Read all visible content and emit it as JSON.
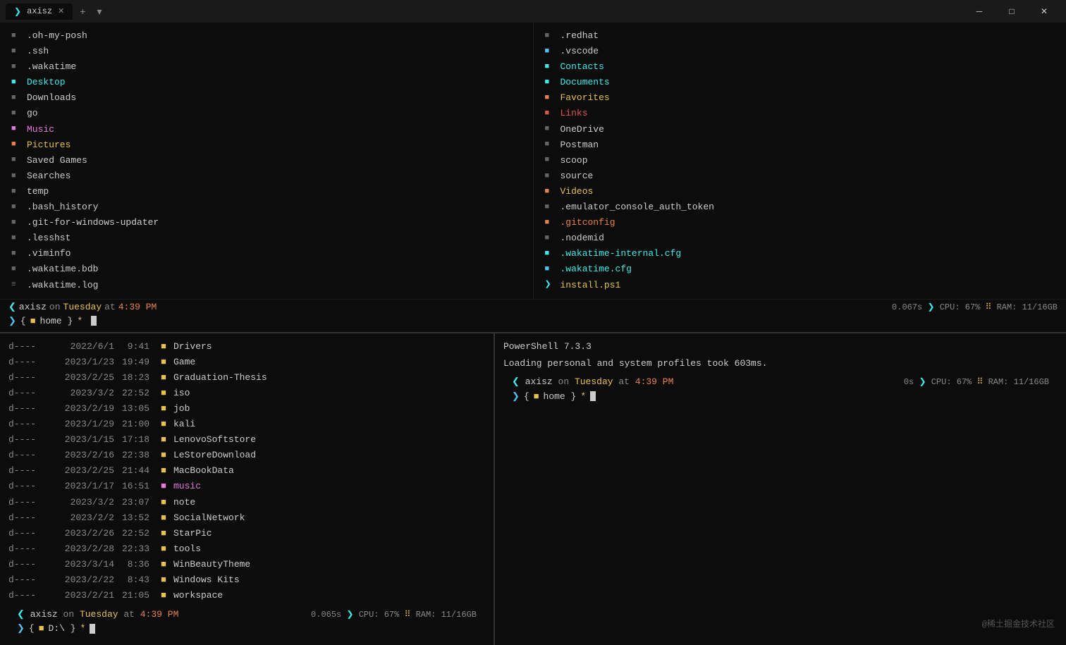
{
  "titlebar": {
    "tab_label": "axisz",
    "add_label": "+",
    "arrow_label": "▾",
    "minimize": "─",
    "maximize": "□",
    "close": "✕"
  },
  "top_pane": {
    "left_files": [
      {
        "icon": "■",
        "icon_color": "gray",
        "name": ".oh-my-posh",
        "name_color": "white"
      },
      {
        "icon": "■",
        "icon_color": "gray",
        "name": ".ssh",
        "name_color": "white"
      },
      {
        "icon": "■",
        "icon_color": "gray",
        "name": ".wakatime",
        "name_color": "white"
      },
      {
        "icon": "■",
        "icon_color": "cyan",
        "name": "Desktop",
        "name_color": "cyan"
      },
      {
        "icon": "■",
        "icon_color": "gray",
        "name": "Downloads",
        "name_color": "white"
      },
      {
        "icon": "■",
        "icon_color": "gray",
        "name": "go",
        "name_color": "white"
      },
      {
        "icon": "■",
        "icon_color": "pink",
        "name": "Music",
        "name_color": "pink"
      },
      {
        "icon": "■",
        "icon_color": "orange",
        "name": "Pictures",
        "name_color": "yellow"
      },
      {
        "icon": "■",
        "icon_color": "gray",
        "name": "Saved Games",
        "name_color": "white"
      },
      {
        "icon": "■",
        "icon_color": "gray",
        "name": "Searches",
        "name_color": "white"
      },
      {
        "icon": "■",
        "icon_color": "gray",
        "name": "temp",
        "name_color": "white"
      },
      {
        "icon": "■",
        "icon_color": "gray",
        "name": ".bash_history",
        "name_color": "white"
      },
      {
        "icon": "■",
        "icon_color": "gray",
        "name": ".git-for-windows-updater",
        "name_color": "white"
      },
      {
        "icon": "■",
        "icon_color": "gray",
        "name": ".lesshst",
        "name_color": "white"
      },
      {
        "icon": "■",
        "icon_color": "gray",
        "name": ".viminfo",
        "name_color": "white"
      },
      {
        "icon": "■",
        "icon_color": "gray",
        "name": ".wakatime.bdb",
        "name_color": "white"
      },
      {
        "icon": "=",
        "icon_color": "gray",
        "name": ".wakatime.log",
        "name_color": "white"
      }
    ],
    "right_files": [
      {
        "icon": "■",
        "icon_color": "gray",
        "name": ".redhat",
        "name_color": "white"
      },
      {
        "icon": "■",
        "icon_color": "blue",
        "name": ".vscode",
        "name_color": "white"
      },
      {
        "icon": "■",
        "icon_color": "cyan",
        "name": "Contacts",
        "name_color": "cyan"
      },
      {
        "icon": "■",
        "icon_color": "cyan",
        "name": "Documents",
        "name_color": "cyan"
      },
      {
        "icon": "■",
        "icon_color": "orange",
        "name": "Favorites",
        "name_color": "yellow"
      },
      {
        "icon": "■",
        "icon_color": "red",
        "name": "Links",
        "name_color": "red"
      },
      {
        "icon": "■",
        "icon_color": "gray",
        "name": "OneDrive",
        "name_color": "white"
      },
      {
        "icon": "■",
        "icon_color": "gray",
        "name": "Postman",
        "name_color": "white"
      },
      {
        "icon": "■",
        "icon_color": "gray",
        "name": "scoop",
        "name_color": "white"
      },
      {
        "icon": "■",
        "icon_color": "gray",
        "name": "source",
        "name_color": "white"
      },
      {
        "icon": "■",
        "icon_color": "orange",
        "name": "Videos",
        "name_color": "yellow"
      },
      {
        "icon": "■",
        "icon_color": "gray",
        "name": ".emulator_console_auth_token",
        "name_color": "white"
      },
      {
        "icon": "■",
        "icon_color": "orange",
        "name": ".gitconfig",
        "name_color": "orange"
      },
      {
        "icon": "■",
        "icon_color": "gray",
        "name": ".nodemid",
        "name_color": "white"
      },
      {
        "icon": "■",
        "icon_color": "cyan",
        "name": ".wakatime-internal.cfg",
        "name_color": "cyan"
      },
      {
        "icon": "■",
        "icon_color": "blue",
        "name": ".wakatime.cfg",
        "name_color": "cyan"
      },
      {
        "icon": ">",
        "icon_color": "cyan",
        "name": "install.ps1",
        "name_color": "yellow"
      }
    ]
  },
  "top_prompt": {
    "user": "axisz",
    "on": "on",
    "day": "Tuesday",
    "at": "at",
    "time": "4:39 PM",
    "duration": "0.067s",
    "cpu_label": "CPU:",
    "cpu_val": "67%",
    "ram_label": "RAM:",
    "ram_val": "11/16GB",
    "cmd": "{ ■ home } *"
  },
  "bottom_left": {
    "dirs": [
      {
        "mode": "d----",
        "date": "2022/6/1",
        "time": "9:41",
        "name": "Drivers",
        "name_color": "white"
      },
      {
        "mode": "d----",
        "date": "2023/1/23",
        "time": "19:49",
        "name": "Game",
        "name_color": "white"
      },
      {
        "mode": "d----",
        "date": "2023/2/25",
        "time": "18:23",
        "name": "Graduation-Thesis",
        "name_color": "white"
      },
      {
        "mode": "d----",
        "date": "2023/3/2",
        "time": "22:52",
        "name": "iso",
        "name_color": "white"
      },
      {
        "mode": "d----",
        "date": "2023/2/19",
        "time": "13:05",
        "name": "job",
        "name_color": "white"
      },
      {
        "mode": "d----",
        "date": "2023/1/29",
        "time": "21:00",
        "name": "kali",
        "name_color": "white"
      },
      {
        "mode": "d----",
        "date": "2023/1/15",
        "time": "17:18",
        "name": "LenovoSoftstore",
        "name_color": "white"
      },
      {
        "mode": "d----",
        "date": "2023/2/16",
        "time": "22:38",
        "name": "LeStoreDownload",
        "name_color": "white"
      },
      {
        "mode": "d----",
        "date": "2023/2/25",
        "time": "21:44",
        "name": "MacBookData",
        "name_color": "white"
      },
      {
        "mode": "d----",
        "date": "2023/1/17",
        "time": "16:51",
        "name": "music",
        "name_color": "pink"
      },
      {
        "mode": "d----",
        "date": "2023/3/2",
        "time": "23:07",
        "name": "note",
        "name_color": "white"
      },
      {
        "mode": "d----",
        "date": "2023/2/2",
        "time": "13:52",
        "name": "SocialNetwork",
        "name_color": "white"
      },
      {
        "mode": "d----",
        "date": "2023/2/26",
        "time": "22:52",
        "name": "StarPic",
        "name_color": "white"
      },
      {
        "mode": "d----",
        "date": "2023/2/28",
        "time": "22:33",
        "name": "tools",
        "name_color": "white"
      },
      {
        "mode": "d----",
        "date": "2023/3/14",
        "time": "8:36",
        "name": "WinBeautyTheme",
        "name_color": "white"
      },
      {
        "mode": "d----",
        "date": "2023/2/22",
        "time": "8:43",
        "name": "Windows Kits",
        "name_color": "white"
      },
      {
        "mode": "d----",
        "date": "2023/2/21",
        "time": "21:05",
        "name": "workspace",
        "name_color": "white"
      }
    ],
    "prompt": {
      "user": "axisz",
      "day": "Tuesday",
      "time": "4:39 PM",
      "duration": "0.065s",
      "cpu_val": "67%",
      "ram_val": "11/16GB",
      "cmd": "{ D:\\ }"
    }
  },
  "bottom_right": {
    "header": "PowerShell 7.3.3",
    "loading": "Loading personal and system profiles took 603ms.",
    "prompt": {
      "user": "axisz",
      "day": "Tuesday",
      "time": "4:39 PM",
      "duration": "0s",
      "cpu_val": "67%",
      "ram_val": "11/16GB",
      "cmd": "{ ■ home } *"
    }
  },
  "watermark": "@稀土掘金技术社区"
}
